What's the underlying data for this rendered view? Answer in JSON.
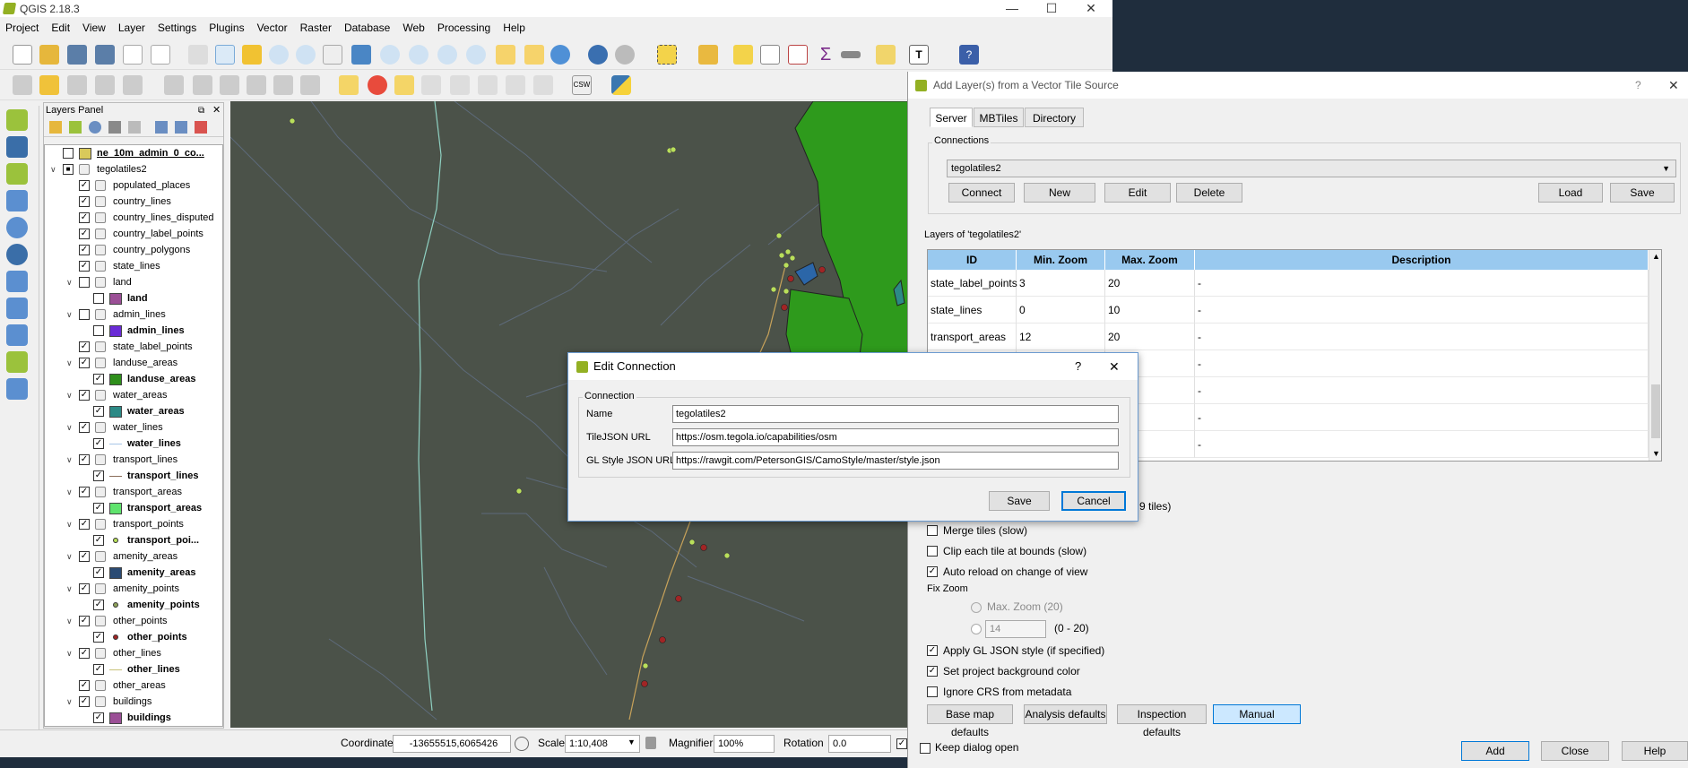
{
  "app": {
    "title": "QGIS 2.18.3",
    "menu": [
      "Project",
      "Edit",
      "View",
      "Layer",
      "Settings",
      "Plugins",
      "Vector",
      "Raster",
      "Database",
      "Web",
      "Processing",
      "Help"
    ]
  },
  "layers_panel": {
    "title": "Layers Panel",
    "rows": [
      {
        "label": "ne_10m_admin_0_co...",
        "bold": true,
        "underline": true,
        "checked": false,
        "level": 0,
        "kind": "layer",
        "swatch": "#d9c95b"
      },
      {
        "label": "tegolatiles2",
        "checked": "partial",
        "level": 0,
        "kind": "group",
        "expanded": true
      },
      {
        "label": "populated_places",
        "checked": true,
        "level": 1,
        "kind": "group"
      },
      {
        "label": "country_lines",
        "checked": true,
        "level": 1,
        "kind": "group"
      },
      {
        "label": "country_lines_disputed",
        "checked": true,
        "level": 1,
        "kind": "group"
      },
      {
        "label": "country_label_points",
        "checked": true,
        "level": 1,
        "kind": "group"
      },
      {
        "label": "country_polygons",
        "checked": true,
        "level": 1,
        "kind": "group"
      },
      {
        "label": "state_lines",
        "checked": true,
        "level": 1,
        "kind": "group"
      },
      {
        "label": "land",
        "checked": false,
        "level": 1,
        "kind": "group",
        "expanded": true
      },
      {
        "label": "land",
        "bold": true,
        "checked": false,
        "level": 2,
        "kind": "layer",
        "swatch": "#9b4f96"
      },
      {
        "label": "admin_lines",
        "checked": false,
        "level": 1,
        "kind": "group",
        "expanded": true
      },
      {
        "label": "admin_lines",
        "bold": true,
        "checked": false,
        "level": 2,
        "kind": "layer",
        "swatch": "#6a2bd6"
      },
      {
        "label": "state_label_points",
        "checked": true,
        "level": 1,
        "kind": "group"
      },
      {
        "label": "landuse_areas",
        "checked": true,
        "level": 1,
        "kind": "group",
        "expanded": true
      },
      {
        "label": "landuse_areas",
        "bold": true,
        "checked": true,
        "level": 2,
        "kind": "layer",
        "swatch": "#2e8f1b"
      },
      {
        "label": "water_areas",
        "checked": true,
        "level": 1,
        "kind": "group",
        "expanded": true
      },
      {
        "label": "water_areas",
        "bold": true,
        "checked": true,
        "level": 2,
        "kind": "layer",
        "swatch": "#2c8a86"
      },
      {
        "label": "water_lines",
        "checked": true,
        "level": 1,
        "kind": "group",
        "expanded": true
      },
      {
        "label": "water_lines",
        "bold": true,
        "checked": true,
        "level": 2,
        "kind": "line",
        "swatch": "#a8c6e8"
      },
      {
        "label": "transport_lines",
        "checked": true,
        "level": 1,
        "kind": "group",
        "expanded": true
      },
      {
        "label": "transport_lines",
        "bold": true,
        "checked": true,
        "level": 2,
        "kind": "line",
        "swatch": "#8a6d5a"
      },
      {
        "label": "transport_areas",
        "checked": true,
        "level": 1,
        "kind": "group",
        "expanded": true
      },
      {
        "label": "transport_areas",
        "bold": true,
        "checked": true,
        "level": 2,
        "kind": "layer",
        "swatch": "#5fe36d"
      },
      {
        "label": "transport_points",
        "checked": true,
        "level": 1,
        "kind": "group",
        "expanded": true
      },
      {
        "label": "transport_poi...",
        "bold": true,
        "checked": true,
        "level": 2,
        "kind": "point",
        "swatch": "#b9e05a"
      },
      {
        "label": "amenity_areas",
        "checked": true,
        "level": 1,
        "kind": "group",
        "expanded": true
      },
      {
        "label": "amenity_areas",
        "bold": true,
        "checked": true,
        "level": 2,
        "kind": "layer",
        "swatch": "#2b4b73"
      },
      {
        "label": "amenity_points",
        "checked": true,
        "level": 1,
        "kind": "group",
        "expanded": true
      },
      {
        "label": "amenity_points",
        "bold": true,
        "checked": true,
        "level": 2,
        "kind": "point",
        "swatch": "#8fa35a"
      },
      {
        "label": "other_points",
        "checked": true,
        "level": 1,
        "kind": "group",
        "expanded": true
      },
      {
        "label": "other_points",
        "bold": true,
        "checked": true,
        "level": 2,
        "kind": "point",
        "swatch": "#a12525"
      },
      {
        "label": "other_lines",
        "checked": true,
        "level": 1,
        "kind": "group",
        "expanded": true
      },
      {
        "label": "other_lines",
        "bold": true,
        "checked": true,
        "level": 2,
        "kind": "line",
        "swatch": "#c9c27a"
      },
      {
        "label": "other_areas",
        "checked": true,
        "level": 1,
        "kind": "group"
      },
      {
        "label": "buildings",
        "checked": true,
        "level": 1,
        "kind": "group",
        "expanded": true
      },
      {
        "label": "buildings",
        "bold": true,
        "checked": true,
        "level": 2,
        "kind": "layer",
        "swatch": "#9b4f96"
      }
    ]
  },
  "status": {
    "coordinate_label": "Coordinate",
    "coordinate_value": "-13655515,6065426",
    "scale_label": "Scale",
    "scale_value": "1:10,408",
    "magnifier_label": "Magnifier",
    "magnifier_value": "100%",
    "rotation_label": "Rotation",
    "rotation_value": "0.0"
  },
  "vector_dialog": {
    "title": "Add Layer(s) from a Vector Tile Source",
    "help_glyph": "?",
    "tabs": [
      "Server",
      "MBTiles",
      "Directory"
    ],
    "connections_label": "Connections",
    "connection_selected": "tegolatiles2",
    "buttons": {
      "connect": "Connect",
      "new": "New",
      "edit": "Edit",
      "delete": "Delete",
      "load": "Load",
      "save": "Save"
    },
    "layers_group_label": "Layers of 'tegolatiles2'",
    "table": {
      "headers": [
        "ID",
        "Min. Zoom",
        "Max. Zoom",
        "Description"
      ],
      "rows": [
        [
          "state_label_points",
          "3",
          "20",
          "-"
        ],
        [
          "state_lines",
          "0",
          "10",
          "-"
        ],
        [
          "transport_areas",
          "12",
          "20",
          "-"
        ],
        [
          "",
          "",
          "",
          "-"
        ],
        [
          "",
          "",
          "",
          "-"
        ],
        [
          "",
          "",
          "",
          "-"
        ],
        [
          "",
          "",
          "",
          "-"
        ]
      ]
    },
    "tiles_suffix": "9 tiles)",
    "options": [
      {
        "label": "Merge tiles (slow)",
        "checked": false
      },
      {
        "label": "Clip each tile at bounds (slow)",
        "checked": false
      },
      {
        "label": "Auto reload on change of view",
        "checked": true
      }
    ],
    "fix_zoom_label": "Fix Zoom",
    "max_zoom_radio": "Max. Zoom (20)",
    "zoom_spin_value": "14",
    "zoom_range": "(0 - 20)",
    "options2": [
      {
        "label": "Apply GL JSON style (if specified)",
        "checked": true
      },
      {
        "label": "Set project background color",
        "checked": true
      },
      {
        "label": "Ignore CRS from metadata",
        "checked": false
      }
    ],
    "presets": [
      "Base map defaults",
      "Analysis defaults",
      "Inspection defaults",
      "Manual"
    ],
    "keep_open_label": "Keep dialog open",
    "footer": {
      "add": "Add",
      "close": "Close",
      "help": "Help"
    }
  },
  "edit_connection": {
    "title": "Edit Connection",
    "help_glyph": "?",
    "group_label": "Connection",
    "name_label": "Name",
    "name_value": "tegolatiles2",
    "tilejson_label": "TileJSON URL",
    "tilejson_value": "https://osm.tegola.io/capabilities/osm",
    "glstyle_label": "GL Style JSON URL",
    "glstyle_value": "https://rawgit.com/PetersonGIS/CamoStyle/master/style.json",
    "save": "Save",
    "cancel": "Cancel"
  },
  "colors": {
    "map_bg": "#4b5249",
    "green_area": "#2e9a1c",
    "selected_header": "#99c9ef",
    "accent": "#0078d7"
  }
}
